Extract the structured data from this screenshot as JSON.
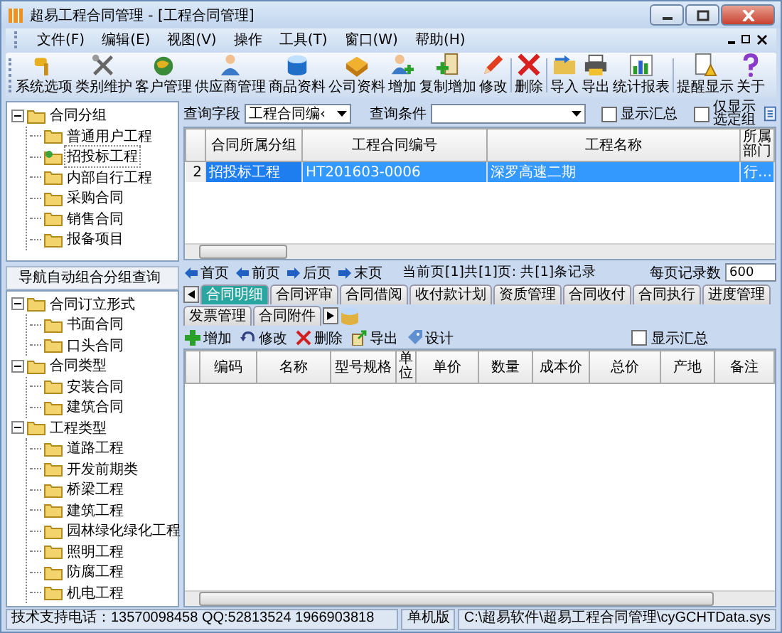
{
  "window": {
    "title": "超易工程合同管理 - [工程合同管理]"
  },
  "menu": [
    "文件(F)",
    "编辑(E)",
    "视图(V)",
    "操作",
    "工具(T)",
    "窗口(W)",
    "帮助(H)"
  ],
  "toolbar": [
    {
      "label": "系统选项"
    },
    {
      "label": "类别维护"
    },
    {
      "label": "客户管理"
    },
    {
      "label": "供应商管理"
    },
    {
      "label": "商品资料"
    },
    {
      "label": "公司资料"
    },
    {
      "label": "增加"
    },
    {
      "label": "复制增加"
    },
    {
      "label": "修改"
    },
    {
      "label": "删除"
    },
    {
      "label": "导入"
    },
    {
      "label": "导出"
    },
    {
      "label": "统计报表"
    },
    {
      "label": "提醒显示"
    },
    {
      "label": "关于"
    }
  ],
  "group_tree": [
    {
      "label": "合同分组",
      "selected": false,
      "expanded": true,
      "children": [
        {
          "label": "普通用户工程",
          "selected": false
        },
        {
          "label": "招投标工程",
          "selected": true
        },
        {
          "label": "内部自行工程",
          "selected": false
        },
        {
          "label": "采购合同",
          "selected": false
        },
        {
          "label": "销售合同",
          "selected": false
        },
        {
          "label": "报备项目",
          "selected": false
        }
      ]
    }
  ],
  "nav_label": "导航自动组合分组查询",
  "nav_tree": [
    {
      "label": "合同订立形式",
      "selected": false,
      "expanded": true,
      "children": [
        {
          "label": "书面合同",
          "selected": false
        },
        {
          "label": "口头合同",
          "selected": false
        }
      ]
    },
    {
      "label": "合同类型",
      "selected": false,
      "expanded": true,
      "children": [
        {
          "label": "安装合同",
          "selected": false
        },
        {
          "label": "建筑合同",
          "selected": false
        }
      ]
    },
    {
      "label": "工程类型",
      "selected": false,
      "expanded": true,
      "children": [
        {
          "label": "道路工程",
          "selected": false
        },
        {
          "label": "开发前期类",
          "selected": false
        },
        {
          "label": "桥梁工程",
          "selected": false
        },
        {
          "label": "建筑工程",
          "selected": false
        },
        {
          "label": "园林绿化绿化工程",
          "selected": false
        },
        {
          "label": "照明工程",
          "selected": false
        },
        {
          "label": "防腐工程",
          "selected": false
        },
        {
          "label": "机电工程",
          "selected": false
        }
      ]
    }
  ],
  "query": {
    "field_label": "查询字段",
    "field_value": "工程合同编‹",
    "condition_label": "查询条件",
    "checkboxes": [
      {
        "label": "显示汇总",
        "checked": false
      },
      {
        "label": "仅显示选定组",
        "checked": false
      }
    ]
  },
  "contract_grid": {
    "columns": [
      "合同所属分组",
      "工程合同编号",
      "工程名称",
      "所属部门"
    ],
    "rows": [
      {
        "row_number": "2",
        "cells": [
          "招投标工程",
          "HT201603-0006",
          "深罗高速二期",
          "行…"
        ],
        "selected": true
      }
    ]
  },
  "pager": {
    "buttons": [
      "首页",
      "前页",
      "后页",
      "末页"
    ],
    "record_info": "当前页[1]共[1]页: 共[1]条记录",
    "page_size_label": "每页记录数",
    "page_size": "600"
  },
  "tabs": [
    {
      "label": "合同明细",
      "selected": true
    },
    {
      "label": "合同评审",
      "selected": false
    },
    {
      "label": "合同借阅",
      "selected": false
    },
    {
      "label": "收付款计划",
      "selected": false
    },
    {
      "label": "资质管理",
      "selected": false
    },
    {
      "label": "合同收付",
      "selected": false
    },
    {
      "label": "合同执行",
      "selected": false
    },
    {
      "label": "进度管理",
      "selected": false
    },
    {
      "label": "发票管理",
      "selected": false
    },
    {
      "label": "合同附件",
      "selected": false
    }
  ],
  "detail_toolbar": {
    "buttons": [
      "增加",
      "修改",
      "删除",
      "导出",
      "设计"
    ],
    "checkbox": {
      "label": "显示汇总",
      "checked": false
    }
  },
  "detail_grid": {
    "columns": [
      "编码",
      "名称",
      "型号规格",
      "单位",
      "单价",
      "数量",
      "成本价",
      "总价",
      "产地",
      "备注"
    ]
  },
  "status_bar": [
    "技术支持电话：13570098458 QQ:52813524 1966903818",
    "单机版",
    "C:\\超易软件\\超易工程合同管理\\cyGCHTData.sys"
  ]
}
